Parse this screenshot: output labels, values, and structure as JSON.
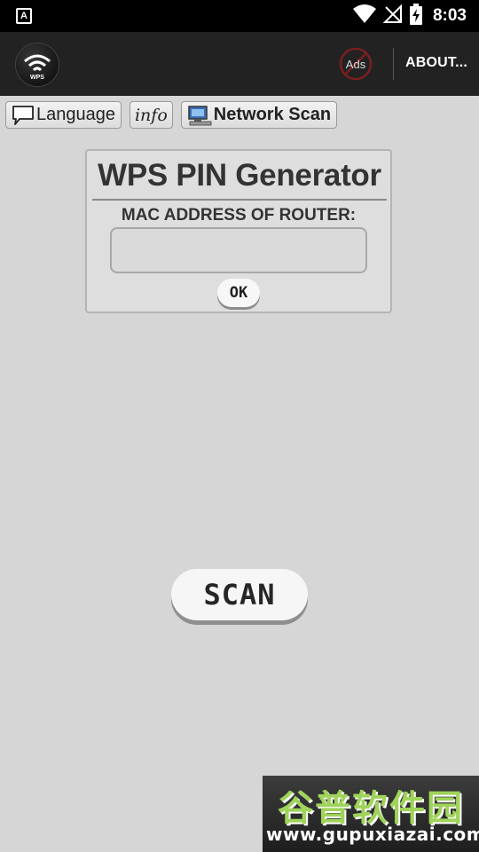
{
  "status_bar": {
    "notification_letter": "A",
    "time": "8:03"
  },
  "app_bar": {
    "logo_text": "WPS",
    "ads_label": "Ads",
    "about_label": "ABOUT..."
  },
  "toolbar": {
    "language_label": "Language",
    "info_label": "info",
    "network_scan_label": "Network Scan"
  },
  "card": {
    "title": "WPS PIN Generator",
    "mac_label": "MAC ADDRESS OF ROUTER:",
    "mac_value": "",
    "ok_label": "OK"
  },
  "scan_label": "SCAN",
  "watermark": {
    "chinese_text": "谷普软件园",
    "url": "www.gupuxiazai.com"
  },
  "colors": {
    "background": "#d6d6d6",
    "app_bar": "#222222",
    "status_bar": "#000000",
    "watermark_green": "#9fd35a"
  }
}
